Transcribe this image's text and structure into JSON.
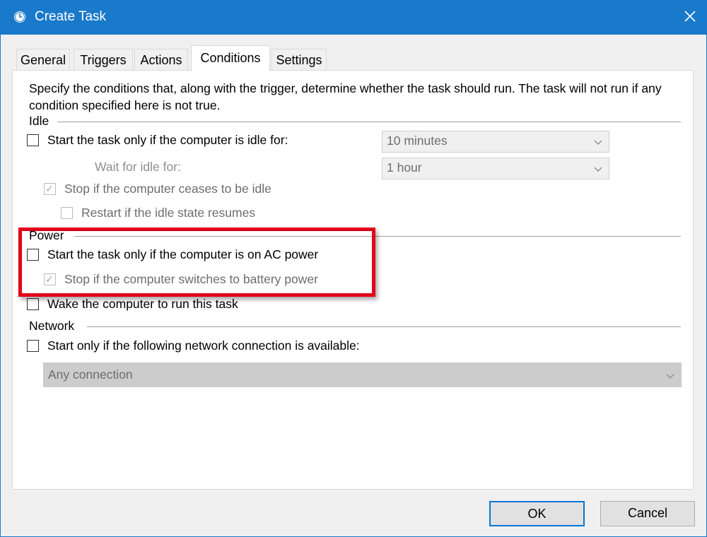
{
  "window": {
    "title": "Create Task"
  },
  "tabs": [
    "General",
    "Triggers",
    "Actions",
    "Conditions",
    "Settings"
  ],
  "active_tab": "Conditions",
  "description": "Specify the conditions that, along with the trigger, determine whether the task should run.  The task will not run  if any condition specified here is not true.",
  "idle": {
    "label": "Idle",
    "start_if_idle": {
      "label": "Start the task only if the computer is idle for:",
      "checked": false
    },
    "idle_duration": "10 minutes",
    "wait_label": "Wait for idle for:",
    "wait_duration": "1 hour",
    "stop_if_not_idle": {
      "label": "Stop if the computer ceases to be idle",
      "checked": true,
      "enabled": false
    },
    "restart_on_idle": {
      "label": "Restart if the idle state resumes",
      "checked": false,
      "enabled": false
    }
  },
  "power": {
    "label": "Power",
    "ac_only": {
      "label": "Start the task only if the computer is on AC power",
      "checked": false
    },
    "stop_on_battery": {
      "label": "Stop if the computer switches to battery power",
      "checked": true,
      "enabled": false
    },
    "wake": {
      "label": "Wake the computer to run this task",
      "checked": false
    }
  },
  "network": {
    "label": "Network",
    "require_network": {
      "label": "Start only if the following network connection is available:",
      "checked": false
    },
    "connection": "Any connection"
  },
  "buttons": {
    "ok": "OK",
    "cancel": "Cancel"
  },
  "colors": {
    "titlebar": "#1979ca",
    "highlight": "#e2001a",
    "default_button_border": "#0078d7"
  },
  "icons": {
    "app": "clock-icon",
    "close": "close-icon",
    "dropdown": "chevron-down-icon"
  }
}
